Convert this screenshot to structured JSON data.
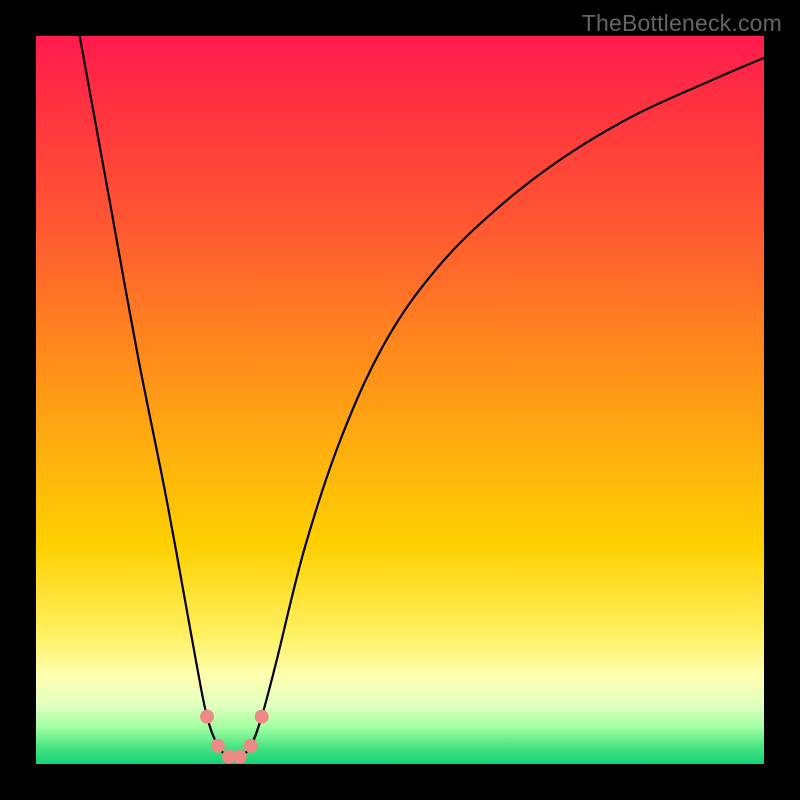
{
  "watermark": "TheBottleneck.com",
  "gradient": {
    "top": "#ff1a4d",
    "bottom": "#14d47a",
    "description": "vertical gradient red→orange→yellow→green"
  },
  "chart_data": {
    "type": "line",
    "title": "",
    "xlabel": "",
    "ylabel": "",
    "xlim": [
      0,
      100
    ],
    "ylim": [
      0,
      100
    ],
    "series": [
      {
        "name": "bottleneck-curve",
        "x": [
          6,
          10,
          14,
          18,
          22,
          23.5,
          25,
          26.5,
          28,
          29.5,
          31,
          33,
          37,
          42,
          48,
          55,
          63,
          72,
          82,
          93,
          100
        ],
        "values": [
          100,
          78,
          56,
          36,
          14,
          6.5,
          2.5,
          1.0,
          1.0,
          2.5,
          6.5,
          14,
          30,
          45,
          58,
          68,
          76,
          83,
          89,
          94,
          97
        ]
      },
      {
        "name": "bottom-dots",
        "x": [
          23.5,
          25.0,
          26.5,
          28.0,
          29.5,
          31.0
        ],
        "values": [
          6.5,
          2.5,
          1.0,
          1.0,
          2.5,
          6.5
        ]
      }
    ],
    "dot_color": "#ec8a87",
    "line_color": "#000000"
  }
}
